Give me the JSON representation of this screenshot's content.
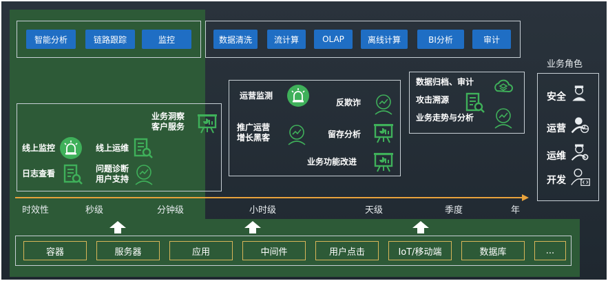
{
  "top_tools_left": [
    "智能分析",
    "链路跟踪",
    "监控"
  ],
  "top_tools_right": [
    "数据清洗",
    "流计算",
    "OLAP",
    "离线计算",
    "BI分析",
    "审计"
  ],
  "realtime_panel": {
    "insight": "业务洞察\n客户服务",
    "online_monitor": "线上监控",
    "online_ops": "线上运维",
    "log_view": "日志查看",
    "diagnosis": "问题诊断\n用户支持"
  },
  "hourly_panel": {
    "ops_monitor": "运营监测",
    "anti_fraud": "反欺诈",
    "promo": "推广运营\n增长黑客",
    "retention": "留存分析",
    "improve": "业务功能改进"
  },
  "season_panel": {
    "archive": "数据归档、审计",
    "trace": "攻击溯源",
    "trend": "业务走势与分析"
  },
  "roles": {
    "title": "业务角色",
    "items": [
      "安全",
      "运营",
      "运维",
      "开发"
    ]
  },
  "timeline": [
    "时效性",
    "秒级",
    "分钟级",
    "小时级",
    "天级",
    "季度",
    "年"
  ],
  "sources": [
    "容器",
    "服务器",
    "应用",
    "中间件",
    "用户点击",
    "IoT/移动端",
    "数据库",
    "..."
  ],
  "colors": {
    "button_blue": "#1f6ec4",
    "green_zone": "#2d5a37",
    "arrow_orange": "#e8a33c",
    "icon_green": "#3fb05a"
  }
}
